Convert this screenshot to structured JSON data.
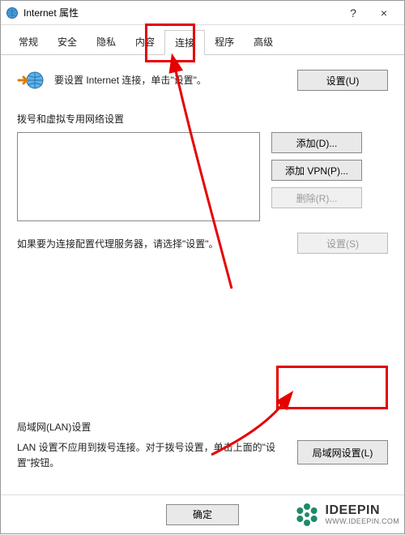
{
  "window": {
    "title": "Internet 属性",
    "help_glyph": "?",
    "close_glyph": "×"
  },
  "tabs": {
    "t0": "常规",
    "t1": "安全",
    "t2": "隐私",
    "t3": "内容",
    "t4": "连接",
    "t5": "程序",
    "t6": "高级"
  },
  "setup": {
    "text": "要设置 Internet 连接，单击\"设置\"。",
    "button": "设置(U)"
  },
  "dial": {
    "label": "拨号和虚拟专用网络设置",
    "add": "添加(D)...",
    "add_vpn": "添加 VPN(P)...",
    "remove": "删除(R)...",
    "hint": "如果要为连接配置代理服务器，请选择\"设置\"。",
    "settings": "设置(S)"
  },
  "lan": {
    "label": "局域网(LAN)设置",
    "text": "LAN 设置不应用到拨号连接。对于拨号设置，单击上面的\"设置\"按钮。",
    "button": "局域网设置(L)"
  },
  "footer": {
    "ok": "确定"
  },
  "watermark": {
    "brand": "IDEEPIN",
    "url": "WWW.IDEEPIN.COM"
  }
}
